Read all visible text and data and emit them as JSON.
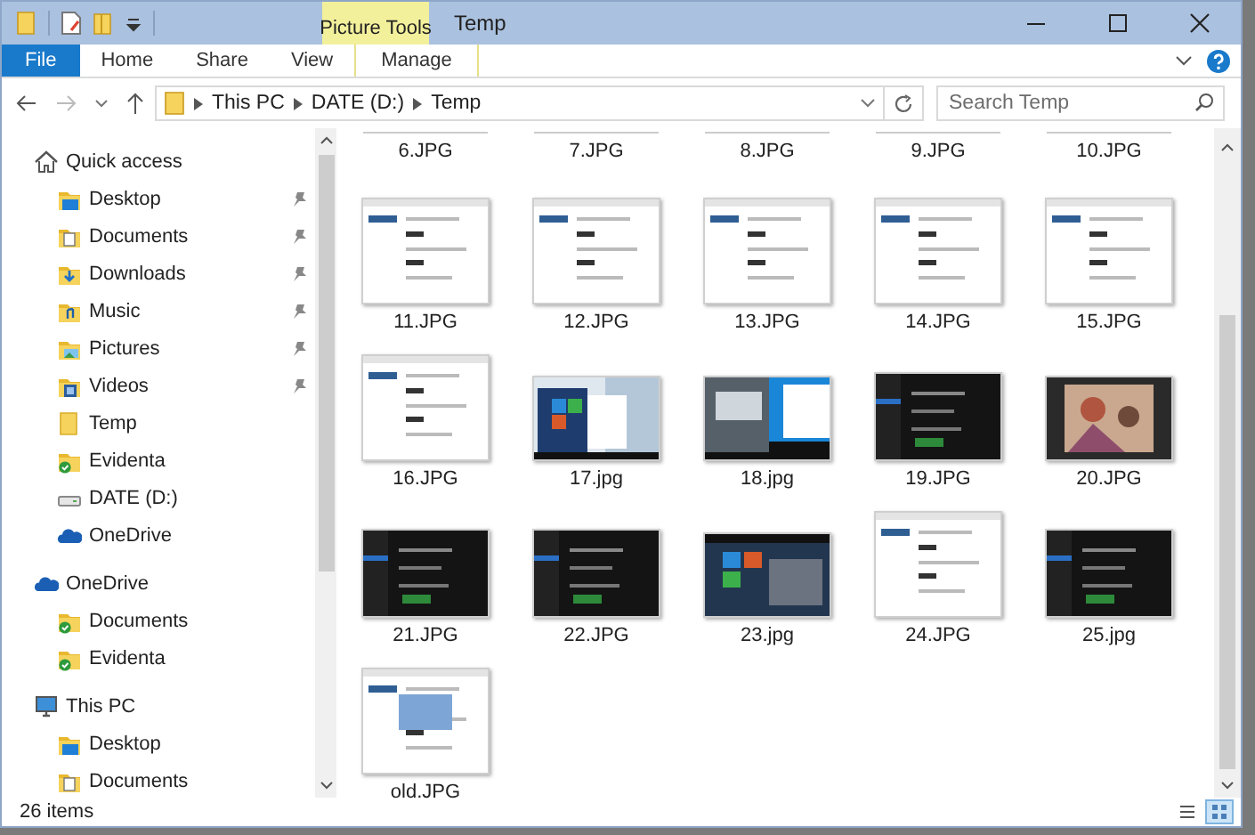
{
  "window": {
    "title": "Temp",
    "context_group": "Picture Tools"
  },
  "ribbon_tabs": [
    {
      "label": "File",
      "kind": "file",
      "selected": false
    },
    {
      "label": "Home",
      "kind": "tab",
      "selected": false
    },
    {
      "label": "Share",
      "kind": "tab",
      "selected": false
    },
    {
      "label": "View",
      "kind": "tab",
      "selected": false
    },
    {
      "label": "Manage",
      "kind": "context",
      "selected": false
    }
  ],
  "address": {
    "segments": [
      "This PC",
      "DATE (D:)",
      "Temp"
    ]
  },
  "search": {
    "placeholder": "Search Temp"
  },
  "nav_pane": {
    "sections": [
      {
        "label": "Quick access",
        "kind": "home",
        "children": [
          {
            "label": "Desktop",
            "kind": "desktop",
            "pinned": true
          },
          {
            "label": "Documents",
            "kind": "documents",
            "pinned": true
          },
          {
            "label": "Downloads",
            "kind": "downloads",
            "pinned": true
          },
          {
            "label": "Music",
            "kind": "music",
            "pinned": true
          },
          {
            "label": "Pictures",
            "kind": "pictures",
            "pinned": true
          },
          {
            "label": "Videos",
            "kind": "videos",
            "pinned": true
          },
          {
            "label": "Temp",
            "kind": "folder",
            "pinned": false
          },
          {
            "label": "Evidenta",
            "kind": "synced",
            "pinned": false
          },
          {
            "label": "DATE (D:)",
            "kind": "drive",
            "pinned": false
          },
          {
            "label": "OneDrive",
            "kind": "cloud",
            "pinned": false
          }
        ]
      },
      {
        "label": "OneDrive",
        "kind": "cloud",
        "children": [
          {
            "label": "Documents",
            "kind": "synced",
            "pinned": false
          },
          {
            "label": "Evidenta",
            "kind": "synced",
            "pinned": false
          }
        ]
      },
      {
        "label": "This PC",
        "kind": "pc",
        "children": [
          {
            "label": "Desktop",
            "kind": "desktop",
            "pinned": false
          },
          {
            "label": "Documents",
            "kind": "documents",
            "pinned": false
          }
        ]
      }
    ]
  },
  "files": [
    {
      "name": "6.JPG",
      "cut_off": true
    },
    {
      "name": "7.JPG",
      "cut_off": true
    },
    {
      "name": "8.JPG",
      "cut_off": true
    },
    {
      "name": "9.JPG",
      "cut_off": true
    },
    {
      "name": "10.JPG",
      "cut_off": true
    },
    {
      "name": "11.JPG",
      "cut_off": false
    },
    {
      "name": "12.JPG",
      "cut_off": false
    },
    {
      "name": "13.JPG",
      "cut_off": false
    },
    {
      "name": "14.JPG",
      "cut_off": false
    },
    {
      "name": "15.JPG",
      "cut_off": false
    },
    {
      "name": "16.JPG",
      "cut_off": false
    },
    {
      "name": "17.jpg",
      "cut_off": false
    },
    {
      "name": "18.jpg",
      "cut_off": false
    },
    {
      "name": "19.JPG",
      "cut_off": false
    },
    {
      "name": "20.JPG",
      "cut_off": false
    },
    {
      "name": "21.JPG",
      "cut_off": false
    },
    {
      "name": "22.JPG",
      "cut_off": false
    },
    {
      "name": "23.jpg",
      "cut_off": false
    },
    {
      "name": "24.JPG",
      "cut_off": false
    },
    {
      "name": "25.jpg",
      "cut_off": false
    },
    {
      "name": "old.JPG",
      "cut_off": false
    }
  ],
  "status_bar": {
    "item_count": "26 items",
    "view_buttons": [
      {
        "kind": "details",
        "selected": false
      },
      {
        "kind": "large_icons",
        "selected": true
      }
    ]
  }
}
